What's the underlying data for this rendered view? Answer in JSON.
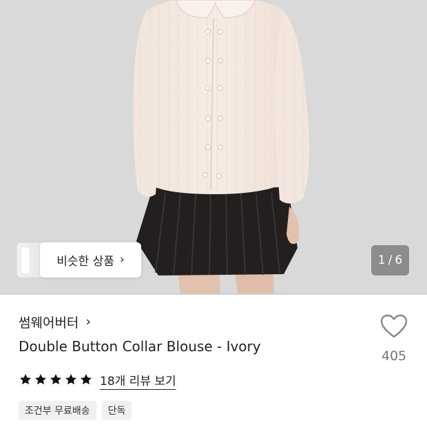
{
  "gallery": {
    "similar_label": "비슷한 상품",
    "similar_chevron": "›",
    "counter_current": "1",
    "counter_sep": "/",
    "counter_total": "6"
  },
  "product": {
    "brand": "썸웨어버터",
    "brand_chevron": "›",
    "title": "Double Button Collar Blouse - Ivory",
    "rating": 5,
    "reviews_label": "18개 리뷰 보기",
    "tags": [
      "조건부 무료배송",
      "단독"
    ]
  },
  "like": {
    "count": "405"
  },
  "colors": {
    "star": "#111111",
    "heart_outline": "#888888"
  },
  "icons": {
    "like": "heart-icon",
    "rating": "star-icon",
    "chevron": "chevron-right-icon"
  }
}
